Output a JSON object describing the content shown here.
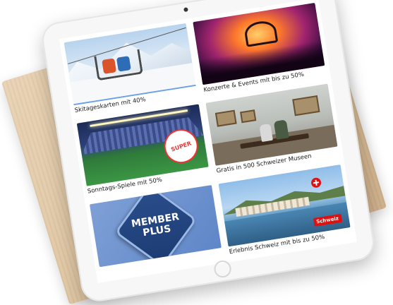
{
  "tiles": [
    {
      "caption": "Skitageskarten mit 40%",
      "image": "ski-lift-photo",
      "accent": "#6aa0e8"
    },
    {
      "caption": "Konzerte & Events mit bis zu 50%",
      "image": "concert-photo",
      "accent": ""
    },
    {
      "caption": "Sonntags-Spiele mit 50%",
      "image": "stadium-photo",
      "badge": "SUPER",
      "accent": ""
    },
    {
      "caption": "Gratis in 500 Schweizer Museen",
      "image": "museum-photo",
      "accent": ""
    },
    {
      "caption": "",
      "image": "member-plus-logo",
      "logo_line1": "MEMBER",
      "logo_line2": "PLUS",
      "accent": ""
    },
    {
      "caption": "Erlebnis Schweiz mit bis zu 50%",
      "image": "swiss-lake-photo",
      "badge": "Schweiz",
      "accent": ""
    }
  ],
  "colors": {
    "member_plus_bg": "#6f93cf",
    "member_plus_logo": "#244a86"
  }
}
